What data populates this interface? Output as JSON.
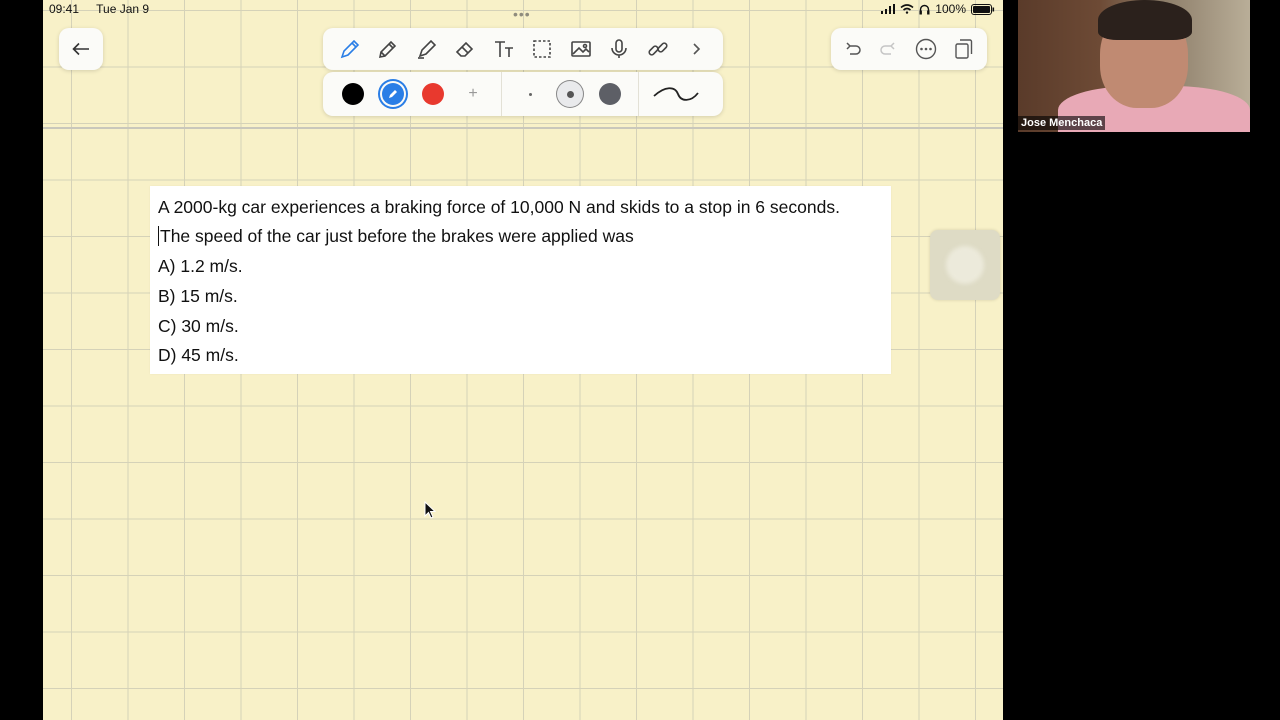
{
  "status_bar": {
    "time": "09:41",
    "date": "Tue Jan 9",
    "battery": "100%"
  },
  "toolbar": {
    "tools": [
      "pen-icon",
      "pencil-icon",
      "highlighter-icon",
      "eraser-icon",
      "text-icon",
      "lasso-icon",
      "image-icon",
      "mic-icon",
      "link-icon",
      "chevron-right-icon"
    ],
    "active_tool": "pen-icon",
    "colors": [
      "#000000",
      "#2a7ee6",
      "#e8392e"
    ],
    "selected_color": "#2a7ee6",
    "add_label": "+",
    "stroke_color": "#5d5f66"
  },
  "question": {
    "line1": "A 2000-kg car experiences a braking force of 10,000 N and skids to a stop in 6 seconds.",
    "line2": "The speed of the car just before the brakes were applied was",
    "options": [
      "A) 1.2 m/s.",
      "B) 15 m/s.",
      "C) 30 m/s.",
      "D) 45 m/s."
    ]
  },
  "webcam": {
    "participant_name": "Jose Menchaca"
  }
}
